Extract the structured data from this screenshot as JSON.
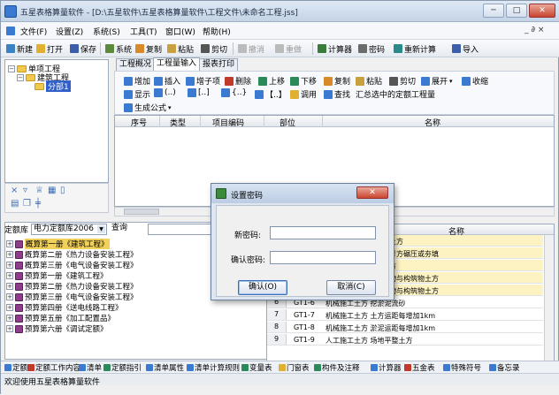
{
  "window": {
    "title": "五星表格算量软件 - [D:\\五星软件\\五星表格算量软件\\工程文件\\未命名工程.jss]",
    "min": "─",
    "max": "□",
    "close": "✕"
  },
  "menu": [
    "文件(F)",
    "设置(Z)",
    "系统(S)",
    "工具(T)",
    "窗口(W)",
    "帮助(H)"
  ],
  "mdi_controls": "_ ∂ ×",
  "toolbar": [
    {
      "label": "新建",
      "icon": "new-file-icon",
      "color": "#3b82c4"
    },
    {
      "label": "打开",
      "icon": "open-folder-icon",
      "color": "#e0b030"
    },
    {
      "label": "保存",
      "icon": "save-icon",
      "color": "#3a5fa8"
    },
    {
      "label": "系统",
      "icon": "system-icon",
      "color": "#5a8a3a"
    },
    {
      "label": "复制",
      "icon": "copy-icon",
      "color": "#d88a2a"
    },
    {
      "label": "粘贴",
      "icon": "paste-icon",
      "color": "#c8a040"
    },
    {
      "label": "剪切",
      "icon": "cut-icon",
      "color": "#555"
    },
    {
      "label": "撤消",
      "icon": "undo-icon",
      "color": "#888"
    },
    {
      "label": "重做",
      "icon": "redo-icon",
      "color": "#888"
    },
    {
      "label": "计算器",
      "icon": "calculator-icon",
      "color": "#3a7a3a"
    },
    {
      "label": "密码",
      "icon": "key-icon",
      "color": "#6b6b6b"
    },
    {
      "label": "重新计算",
      "icon": "recalc-icon",
      "color": "#2a8a8a"
    },
    {
      "label": "导入",
      "icon": "import-icon",
      "color": "#3b5fa8"
    }
  ],
  "tree": {
    "root": "单项工程",
    "child": "建筑工程",
    "leaf": "分部1"
  },
  "tabs": [
    "工程概况",
    "工程量输入",
    "报表打印"
  ],
  "ribbon": {
    "row1": [
      "增加",
      "插入",
      "增子项",
      "删除",
      "上移",
      "下移",
      "复制",
      "粘贴",
      "剪切",
      "展开",
      "收缩"
    ],
    "row2": [
      "显示",
      "(..)",
      "[..]",
      "{..}",
      "【..】",
      "调用",
      "查找",
      "汇总选中的定额工程量"
    ],
    "row3": [
      "生成公式"
    ]
  },
  "grid_headers": [
    "序号",
    "类型",
    "项目编码",
    "部位",
    "名称"
  ],
  "library": {
    "label": "定额库",
    "selected": "电力定额库2006",
    "query_label": "查询",
    "books": [
      "概算第一册《建筑工程》",
      "概算第二册《热力设备安装工程》",
      "概算第三册《电气设备安装工程》",
      "预算第一册《建筑工程》",
      "预算第二册《热力设备安装工程》",
      "预算第三册《电气设备安装工程》",
      "预算第四册《送电线路工程》",
      "预算第五册《加工配置品》",
      "预算第六册《调试定额》"
    ]
  },
  "table2": {
    "header": "名称",
    "rows": [
      {
        "num": "",
        "code": "",
        "name": "整土方"
      },
      {
        "num": "",
        "code": "",
        "name": "整号方碾压或夯填"
      },
      {
        "num": "",
        "code": "",
        "name": "土方"
      },
      {
        "num": "",
        "code": "",
        "name": "筑物与构筑物土方"
      },
      {
        "num": "",
        "code": "",
        "name": "筑物与构筑物土方"
      },
      {
        "num": "6",
        "code": "GT1-6",
        "name": "机械施工土方 挖淤泥流砂"
      },
      {
        "num": "7",
        "code": "GT1-7",
        "name": "机械施工土方 土方运距每增加1km"
      },
      {
        "num": "8",
        "code": "GT1-8",
        "name": "机械施工土方 淤泥运距每增加1km"
      },
      {
        "num": "9",
        "code": "GT1-9",
        "name": "人工施工土方 场地平整土方"
      }
    ]
  },
  "bottom_tabs": [
    "定额",
    "定额工作内容",
    "清单",
    "定额指引",
    "清单属性",
    "清单计算规则",
    "变量表",
    "门窗表",
    "构件及注释",
    "计算器",
    "五金表",
    "特殊符号",
    "备忘录"
  ],
  "status": "欢迎使用五星表格算量软件",
  "dialog": {
    "title": "设置密码",
    "close": "✕",
    "new_password_label": "新密码:",
    "confirm_password_label": "确认密码:",
    "ok_label": "确认(O)",
    "cancel_label": "取消(C)"
  }
}
